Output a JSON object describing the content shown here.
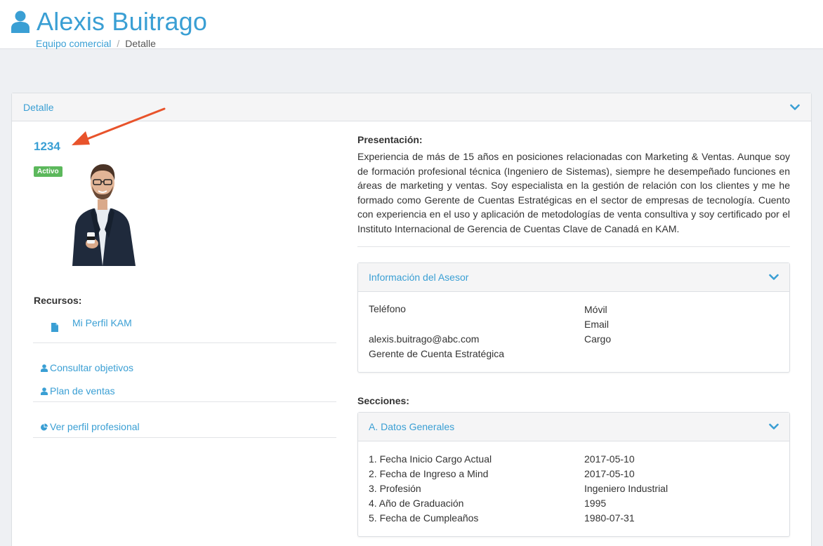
{
  "header": {
    "title": "Alexis Buitrago",
    "breadcrumb": [
      "Equipo comercial",
      "Detalle"
    ]
  },
  "panel": {
    "title": "Detalle"
  },
  "profile": {
    "id": "1234",
    "status": "Activo",
    "resources_label": "Recursos:",
    "resource_link": "Mi Perfil KAM",
    "links": [
      "Consultar objetivos",
      "Plan de ventas",
      "Ver perfil profesional"
    ]
  },
  "presentation": {
    "label": "Presentación:",
    "text": "Experiencia de más de 15 años en posiciones relacionadas con Marketing & Ventas. Aunque soy de formación profesional técnica (Ingeniero de Sistemas), siempre he desempeñado funciones en áreas de marketing y ventas. Soy especialista en la gestión de relación con los clientes y me he formado como Gerente de Cuentas Estratégicas en el sector de empresas de tecnología. Cuento con experiencia en el uso y aplicación de metodologías de venta consultiva y soy certificado por el Instituto Internacional de Gerencia de Cuentas Clave de Canadá en KAM."
  },
  "advisor": {
    "title": "Información del Asesor",
    "telefono": "Teléfono",
    "movil": "Móvil",
    "email_label": "Email",
    "email": "alexis.buitrago@abc.com",
    "cargo_label": "Cargo",
    "cargo": "Gerente de Cuenta Estratégica"
  },
  "sections": {
    "label": "Secciones:",
    "card_title": "A. Datos Generales",
    "rows": [
      {
        "label": "1. Fecha Inicio Cargo Actual",
        "value": "2017-05-10"
      },
      {
        "label": "2. Fecha de Ingreso a Mind",
        "value": "2017-05-10"
      },
      {
        "label": "3. Profesión",
        "value": "Ingeniero Industrial"
      },
      {
        "label": "4. Año de Graduación",
        "value": "1995"
      },
      {
        "label": "5. Fecha de Cumpleaños",
        "value": "1980-07-31"
      }
    ]
  },
  "colors": {
    "accent": "#3a9fd4",
    "active_badge": "#5cb85c",
    "annotation_arrow": "#e8532b"
  }
}
